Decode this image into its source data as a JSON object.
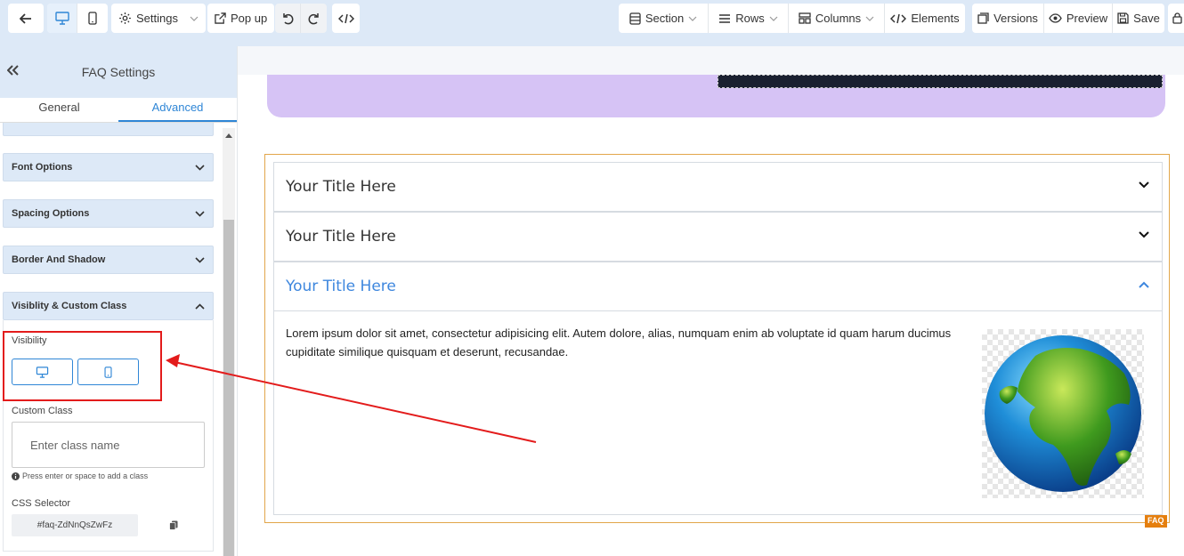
{
  "toolbar": {
    "settings_label": "Settings",
    "popup_label": "Pop up",
    "section_label": "Section",
    "rows_label": "Rows",
    "columns_label": "Columns",
    "elements_label": "Elements",
    "versions_label": "Versions",
    "preview_label": "Preview",
    "save_label": "Save"
  },
  "panel": {
    "title": "FAQ Settings",
    "tabs": [
      {
        "label": "General",
        "active": false
      },
      {
        "label": "Advanced",
        "active": true
      }
    ],
    "sections": [
      {
        "label": "Font Options",
        "expanded": false
      },
      {
        "label": "Spacing Options",
        "expanded": false
      },
      {
        "label": "Border And Shadow",
        "expanded": false
      },
      {
        "label": "Visiblity & Custom Class",
        "expanded": true
      }
    ],
    "visibility_label": "Visibility",
    "custom_class_label": "Custom Class",
    "custom_class_placeholder": "Enter class name",
    "custom_class_hint": "Press enter or space to add a class",
    "css_selector_label": "CSS Selector",
    "css_selector_value": "#faq-ZdNnQsZwFz"
  },
  "faq": {
    "items": [
      {
        "title": "Your Title Here",
        "open": false
      },
      {
        "title": "Your Title Here",
        "open": false
      },
      {
        "title": "Your Title Here",
        "open": true
      }
    ],
    "body_text": "Lorem ipsum dolor sit amet, consectetur adipisicing elit. Autem dolore, alias, numquam enim ab voluptate id quam harum ducimus cupiditate similique quisquam et deserunt, recusandae.",
    "tag": "FAQ"
  },
  "colors": {
    "accent": "#2f86d6",
    "toolbar_bg": "#dde9f7",
    "faq_open_title": "#3e87de",
    "annotation": "#e31b1b",
    "faq_border": "#e2a64a"
  }
}
